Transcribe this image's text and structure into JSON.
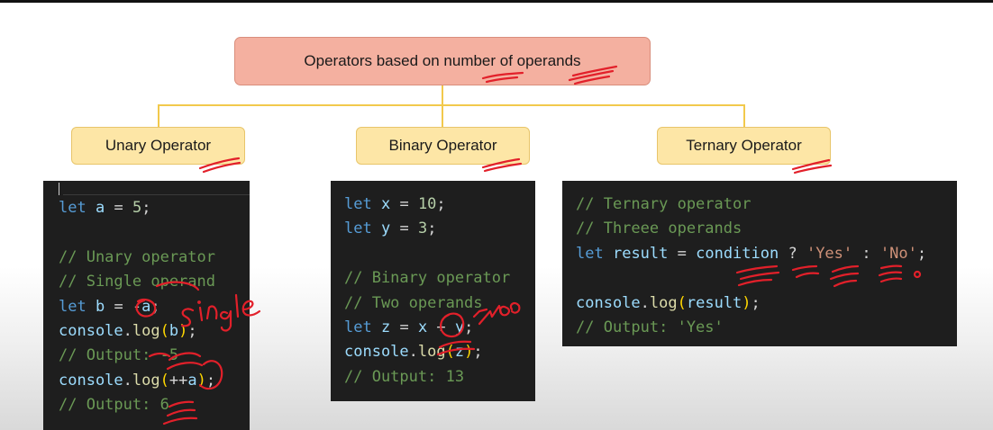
{
  "diagram": {
    "root_label": "Operators based on number of operands",
    "branches": [
      {
        "label": "Unary Operator"
      },
      {
        "label": "Binary Operator"
      },
      {
        "label": "Ternary Operator"
      }
    ]
  },
  "code_panels": {
    "unary": [
      [
        [
          "let",
          "kw"
        ],
        [
          " ",
          ""
        ],
        [
          "a",
          "var"
        ],
        [
          " = ",
          ""
        ],
        [
          "5",
          "num"
        ],
        [
          ";",
          ""
        ]
      ],
      [],
      [
        [
          "// Unary operator",
          "cm"
        ]
      ],
      [
        [
          "// Single operand",
          "cm"
        ]
      ],
      [
        [
          "let",
          "kw"
        ],
        [
          " ",
          ""
        ],
        [
          "b",
          "var"
        ],
        [
          " = -",
          ""
        ],
        [
          "a",
          "var"
        ],
        [
          ";",
          ""
        ]
      ],
      [
        [
          "console",
          "var"
        ],
        [
          ".",
          ""
        ],
        [
          "log",
          "fn"
        ],
        [
          "(",
          "pn"
        ],
        [
          "b",
          "var"
        ],
        [
          ")",
          "pn"
        ],
        [
          ";",
          ""
        ]
      ],
      [
        [
          "// Output: -5",
          "cm"
        ]
      ],
      [
        [
          "console",
          "var"
        ],
        [
          ".",
          ""
        ],
        [
          "log",
          "fn"
        ],
        [
          "(",
          "pn"
        ],
        [
          "++",
          ""
        ],
        [
          "a",
          "var"
        ],
        [
          ")",
          "pn"
        ],
        [
          ";",
          ""
        ]
      ],
      [
        [
          "// Output: 6",
          "cm"
        ]
      ]
    ],
    "binary": [
      [
        [
          "let",
          "kw"
        ],
        [
          " ",
          ""
        ],
        [
          "x",
          "var"
        ],
        [
          " = ",
          ""
        ],
        [
          "10",
          "num"
        ],
        [
          ";",
          ""
        ]
      ],
      [
        [
          "let",
          "kw"
        ],
        [
          " ",
          ""
        ],
        [
          "y",
          "var"
        ],
        [
          " = ",
          ""
        ],
        [
          "3",
          "num"
        ],
        [
          ";",
          ""
        ]
      ],
      [],
      [
        [
          "// Binary operator",
          "cm"
        ]
      ],
      [
        [
          "// Two operands",
          "cm"
        ]
      ],
      [
        [
          "let",
          "kw"
        ],
        [
          " ",
          ""
        ],
        [
          "z",
          "var"
        ],
        [
          " = ",
          ""
        ],
        [
          "x",
          "var"
        ],
        [
          " + ",
          ""
        ],
        [
          "y",
          "var"
        ],
        [
          ";",
          ""
        ]
      ],
      [
        [
          "console",
          "var"
        ],
        [
          ".",
          ""
        ],
        [
          "log",
          "fn"
        ],
        [
          "(",
          "pn"
        ],
        [
          "z",
          "var"
        ],
        [
          ")",
          "pn"
        ],
        [
          ";",
          ""
        ]
      ],
      [
        [
          "// Output: 13",
          "cm"
        ]
      ]
    ],
    "ternary": [
      [
        [
          "// Ternary operator",
          "cm"
        ]
      ],
      [
        [
          "// Threee operands",
          "cm"
        ]
      ],
      [
        [
          "let",
          "kw"
        ],
        [
          " ",
          ""
        ],
        [
          "result",
          "var"
        ],
        [
          " = ",
          ""
        ],
        [
          "condition",
          "var"
        ],
        [
          " ? ",
          ""
        ],
        [
          "'Yes'",
          "str"
        ],
        [
          " : ",
          ""
        ],
        [
          "'No'",
          "str"
        ],
        [
          ";",
          ""
        ]
      ],
      [],
      [
        [
          "console",
          "var"
        ],
        [
          ".",
          ""
        ],
        [
          "log",
          "fn"
        ],
        [
          "(",
          "pn"
        ],
        [
          "result",
          "var"
        ],
        [
          ")",
          "pn"
        ],
        [
          ";",
          ""
        ]
      ],
      [
        [
          "// Output: 'Yes'",
          "cm"
        ]
      ]
    ]
  },
  "annotations": {
    "unary_note": "single",
    "binary_note": "two"
  },
  "colors": {
    "root_fill": "#f4b0a0",
    "node_fill": "#fde6a6",
    "connector": "#f2c94c",
    "code_bg": "#1e1e1e",
    "ink": "#e2202a"
  }
}
